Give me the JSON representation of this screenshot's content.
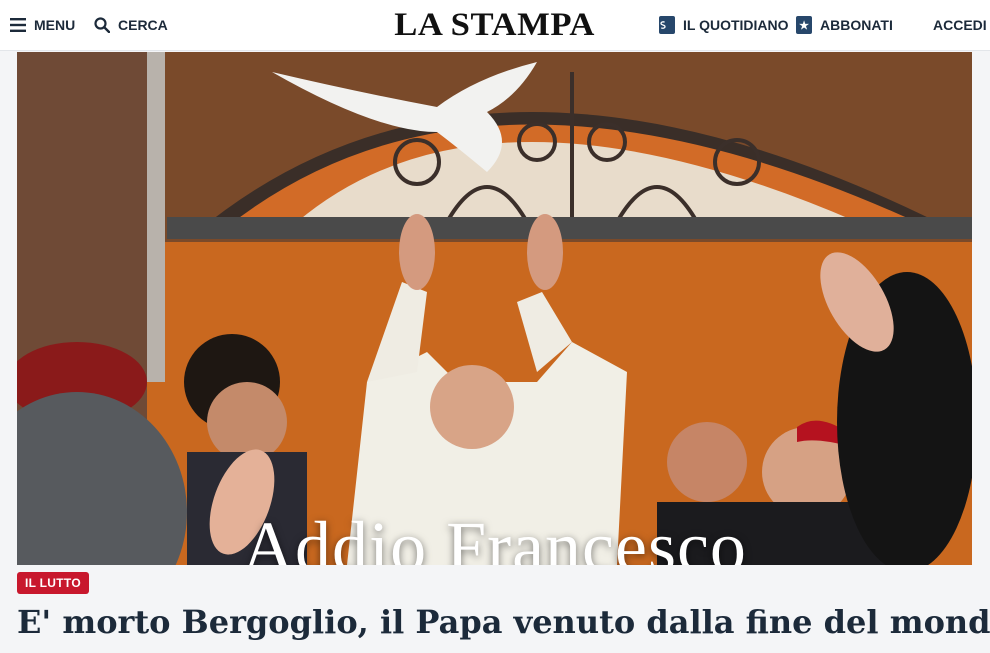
{
  "header": {
    "menu_label": "MENU",
    "search_label": "CERCA",
    "logo_text": "LA STAMPA",
    "newspaper_label": "IL QUOTIDIANO",
    "subscribe_label": "ABBONATI",
    "login_label": "ACCEDI"
  },
  "hero": {
    "overlay_title": "Addio Francesco"
  },
  "article": {
    "tag": "IL LUTTO",
    "headline": "E' morto Bergoglio, il Papa venuto dalla fine del mondo"
  },
  "colors": {
    "tag_red": "#c8182d",
    "header_icon_blue": "#27476b",
    "text_dark": "#1c2a3a"
  }
}
